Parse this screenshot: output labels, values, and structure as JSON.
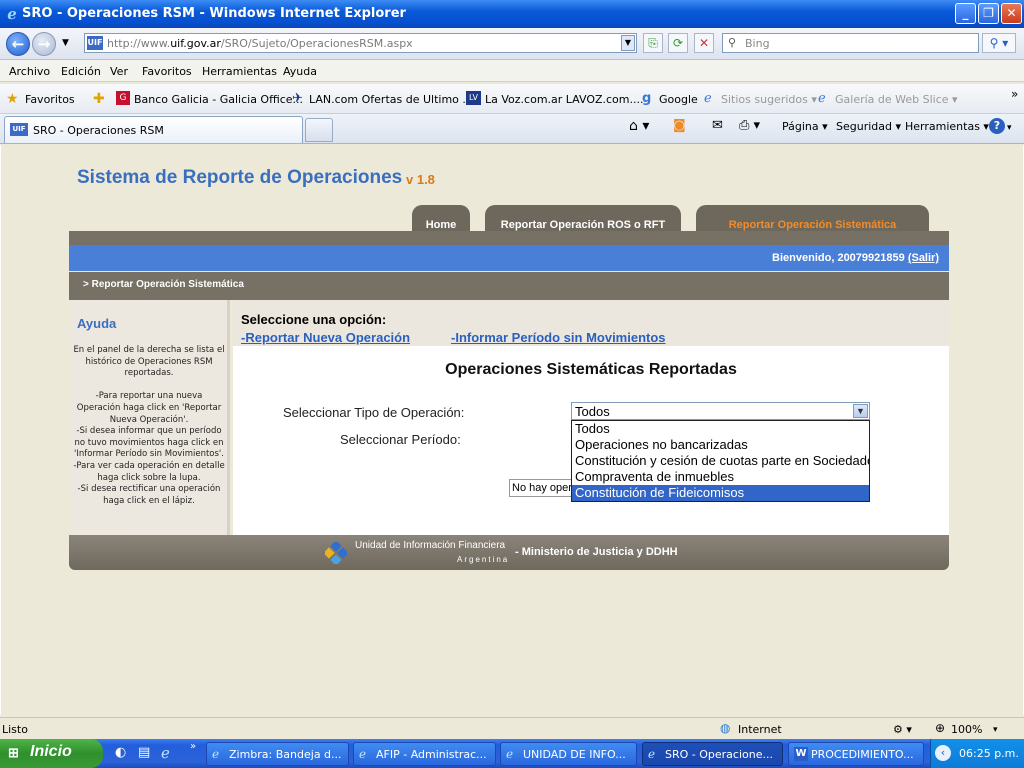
{
  "window": {
    "title": "SRO - Operaciones RSM - Windows Internet Explorer"
  },
  "address": {
    "url_prefix": "http://www.",
    "url_domain": "uif.gov.ar",
    "url_path": "/SRO/Sujeto/OperacionesRSM.aspx",
    "search_placeholder": "Bing"
  },
  "menu": [
    "Archivo",
    "Edición",
    "Ver",
    "Favoritos",
    "Herramientas",
    "Ayuda"
  ],
  "favorites": {
    "label": "Favoritos",
    "items": [
      "Banco Galicia - Galicia Office...",
      "LAN.com Ofertas de Ultimo ...",
      "La Voz.com.ar  LAVOZ.com....",
      "Google",
      "Sitios sugeridos ▾",
      "Galería de Web Slice ▾"
    ]
  },
  "tabs": {
    "active": "SRO - Operaciones RSM",
    "commands": [
      "Página ▾",
      "Seguridad ▾",
      "Herramientas ▾"
    ]
  },
  "site": {
    "title": "Sistema de Reporte de Operaciones",
    "version": "v 1.8",
    "nav": [
      "Home",
      "Reportar Operación ROS o RFT",
      "Reportar Operación Sistemática"
    ],
    "welcome": "Bienvenido, 20079921859",
    "logout": "(Salir)",
    "breadcrumb": "> Reportar Operación Sistemática",
    "help_title": "Ayuda",
    "help_text": "En el panel de la derecha se lista el histórico de Operaciones RSM reportadas.\n\n-Para reportar una nueva Operación haga click en 'Reportar Nueva Operación'.\n-Si desea informar que un período no tuvo movimientos haga click en 'Informar Período sin Movimientos'.\n-Para ver cada operación en detalle haga click sobre la lupa.\n-Si desea rectificar una operación haga click en el lápiz.",
    "select_option": "Seleccione una opción:",
    "link_new": "-Reportar Nueva Operación",
    "link_no_mov": "-Informar Período sin Movimientos",
    "section_title": "Operaciones Sistemáticas Reportadas",
    "label_tipo": "Seleccionar Tipo de Operación:",
    "label_periodo": "Seleccionar Período:",
    "selected_tipo": "Todos",
    "no_results": "No hay operaciones",
    "dropdown_options": [
      "Todos",
      "Operaciones no bancarizadas",
      "Constitución y cesión de cuotas parte en Sociedades",
      "Compraventa de inmuebles",
      "Constitución de Fideicomisos"
    ],
    "footer_uif": "Unidad de Información Financiera",
    "footer_argentina": "Argentina",
    "footer_ministry": "- Ministerio de Justicia y DDHH"
  },
  "status": {
    "left": "Listo",
    "zone": "Internet",
    "zoom": "100%"
  },
  "taskbar": {
    "start": "Inicio",
    "tasks": [
      "Zimbra: Bandeja d...",
      "AFIP - Administrac...",
      "UNIDAD DE INFO...",
      "SRO - Operacione...",
      "PROCEDIMIENTO..."
    ],
    "clock": "06:25 p.m."
  }
}
